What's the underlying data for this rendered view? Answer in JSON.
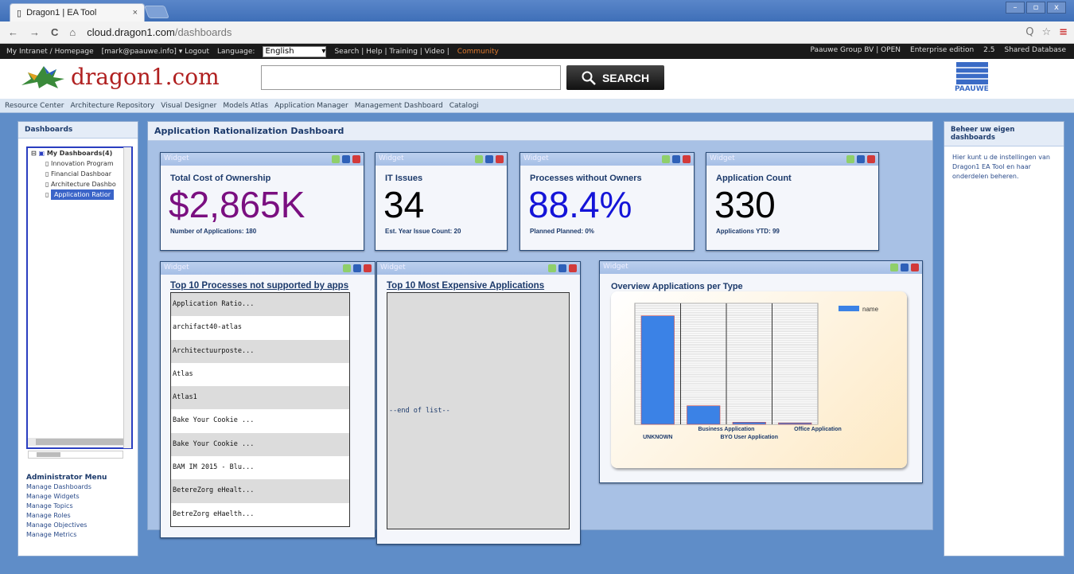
{
  "browser": {
    "tab_title": "Dragon1 | EA Tool",
    "tab_close": "×",
    "url_host": "cloud.dragon1.com",
    "url_path": "/dashboards",
    "nav_back": "←",
    "nav_forward": "→",
    "reload": "C",
    "home": "⌂",
    "zoom": "Q",
    "bookmark": "☆",
    "menu": "≡",
    "win_min": "–",
    "win_max": "▫",
    "win_close": "x"
  },
  "menubar": {
    "intranet": "My Intranet / Homepage",
    "user": "[mark@paauwe.info] ▾ Logout",
    "language_label": "Language:",
    "language_value": "English",
    "links": "Search | Help | Training | Video |",
    "community": "Community",
    "org": "Paauwe Group BV | OPEN",
    "edition": "Enterprise edition",
    "version": "2.5",
    "db": "Shared Database"
  },
  "header": {
    "logo_text": "dragon1.com",
    "search_label": "SEARCH",
    "partner_logo": "PAAUWE"
  },
  "nav": [
    "Resource Center",
    "Architecture Repository",
    "Visual Designer",
    "Models Atlas",
    "Application Manager",
    "Management Dashboard",
    "Catalogi"
  ],
  "left": {
    "title": "Dashboards",
    "tree_root": "My Dashboards(4)",
    "tree_items": [
      "Innovation Program",
      "Financial Dashboar",
      "Architecture Dashbo",
      "Application Ratior"
    ],
    "admin_title": "Administrator Menu",
    "admin_items": [
      "Manage Dashboards",
      "Manage Widgets",
      "Manage Topics",
      "Manage Roles",
      "Manage Objectives",
      "Manage Metrics"
    ]
  },
  "main": {
    "title": "Application Rationalization Dashboard",
    "widget_label": "Widget",
    "kpis": [
      {
        "title": "Total Cost of Ownership",
        "value": "$2,865K",
        "sub": "Number of Applications: 180",
        "color": "#7a0f80"
      },
      {
        "title": "IT Issues",
        "value": "34",
        "sub": "Est. Year Issue Count: 20",
        "color": "#000000"
      },
      {
        "title": "Processes without Owners",
        "value": "88.4%",
        "sub": "Planned Planned: 0%",
        "color": "#1414d8"
      },
      {
        "title": "Application Count",
        "value": "330",
        "sub": "Applications YTD: 99",
        "color": "#000000"
      }
    ],
    "list1": {
      "title": "Top 10 Processes not supported by apps",
      "items": [
        "Application Ratio...",
        "archifact40-atlas",
        "Architectuurposte...",
        "Atlas",
        "Atlas1",
        "Bake Your Cookie ...",
        "Bake Your Cookie ...",
        "BAM IM 2015 - Blu...",
        "BetereZorg eHealt...",
        "BetreZorg eHaelth..."
      ]
    },
    "list2": {
      "title": "Top 10 Most Expensive Applications",
      "end": "--end of list--"
    },
    "chart_widget_title": "Overview Applications per Type"
  },
  "right": {
    "title": "Beheer uw eigen dashboards",
    "text": "Hier kunt u de instellingen van Dragon1 EA Tool en haar onderdelen beheren."
  },
  "chart_data": {
    "type": "bar",
    "title": "Overview Applications per Type",
    "categories": [
      "UNKNOWN",
      "Business Application",
      "BYO User Application",
      "Office Application"
    ],
    "series": [
      {
        "name": "name",
        "values": [
          305,
          52,
          6,
          4
        ]
      }
    ],
    "ylim": [
      0,
      340
    ],
    "legend": "top-right",
    "grid": true,
    "bar_color": "#3b82e6"
  }
}
